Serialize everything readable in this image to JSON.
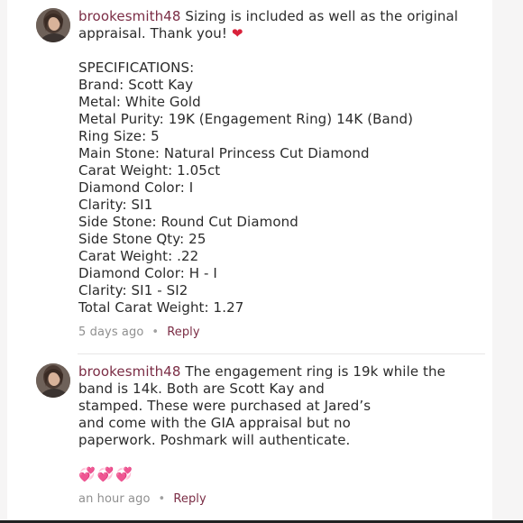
{
  "comments": [
    {
      "username": "brookesmith48",
      "text_lines": [
        "Sizing is included as well as the original",
        "appraisal. Thank you!"
      ],
      "spec_lines": [
        "SPECIFICATIONS:",
        "Brand: Scott Kay",
        "Metal: White Gold",
        "Metal Purity: 19K (Engagement Ring) 14K (Band)",
        "Ring Size: 5",
        "Main Stone: Natural Princess Cut Diamond",
        "Carat Weight: 1.05ct",
        "Diamond Color: I",
        "Clarity: SI1",
        "Side Stone: Round Cut Diamond",
        "Side Stone Qty: 25",
        "Carat Weight: .22",
        "Diamond Color: H - I",
        "Clarity: SI1 - SI2",
        "Total Carat Weight: 1.27"
      ],
      "timestamp": "5 days ago",
      "reply_label": "Reply"
    },
    {
      "username": "brookesmith48",
      "text_lines": [
        "The engagement ring is 19k while the",
        "band is 14k. Both are Scott Kay and",
        "stamped. These were purchased at Jared’s",
        "and come with the GIA appraisal but no",
        "paperwork. Poshmark will authenticate."
      ],
      "timestamp": "an hour ago",
      "reply_label": "Reply"
    }
  ],
  "separator": "•",
  "colors": {
    "username": "#7b2d45",
    "meta": "#8f8f8f",
    "heart": "#d9213a",
    "sparkle_hearts": "#e0459b"
  }
}
